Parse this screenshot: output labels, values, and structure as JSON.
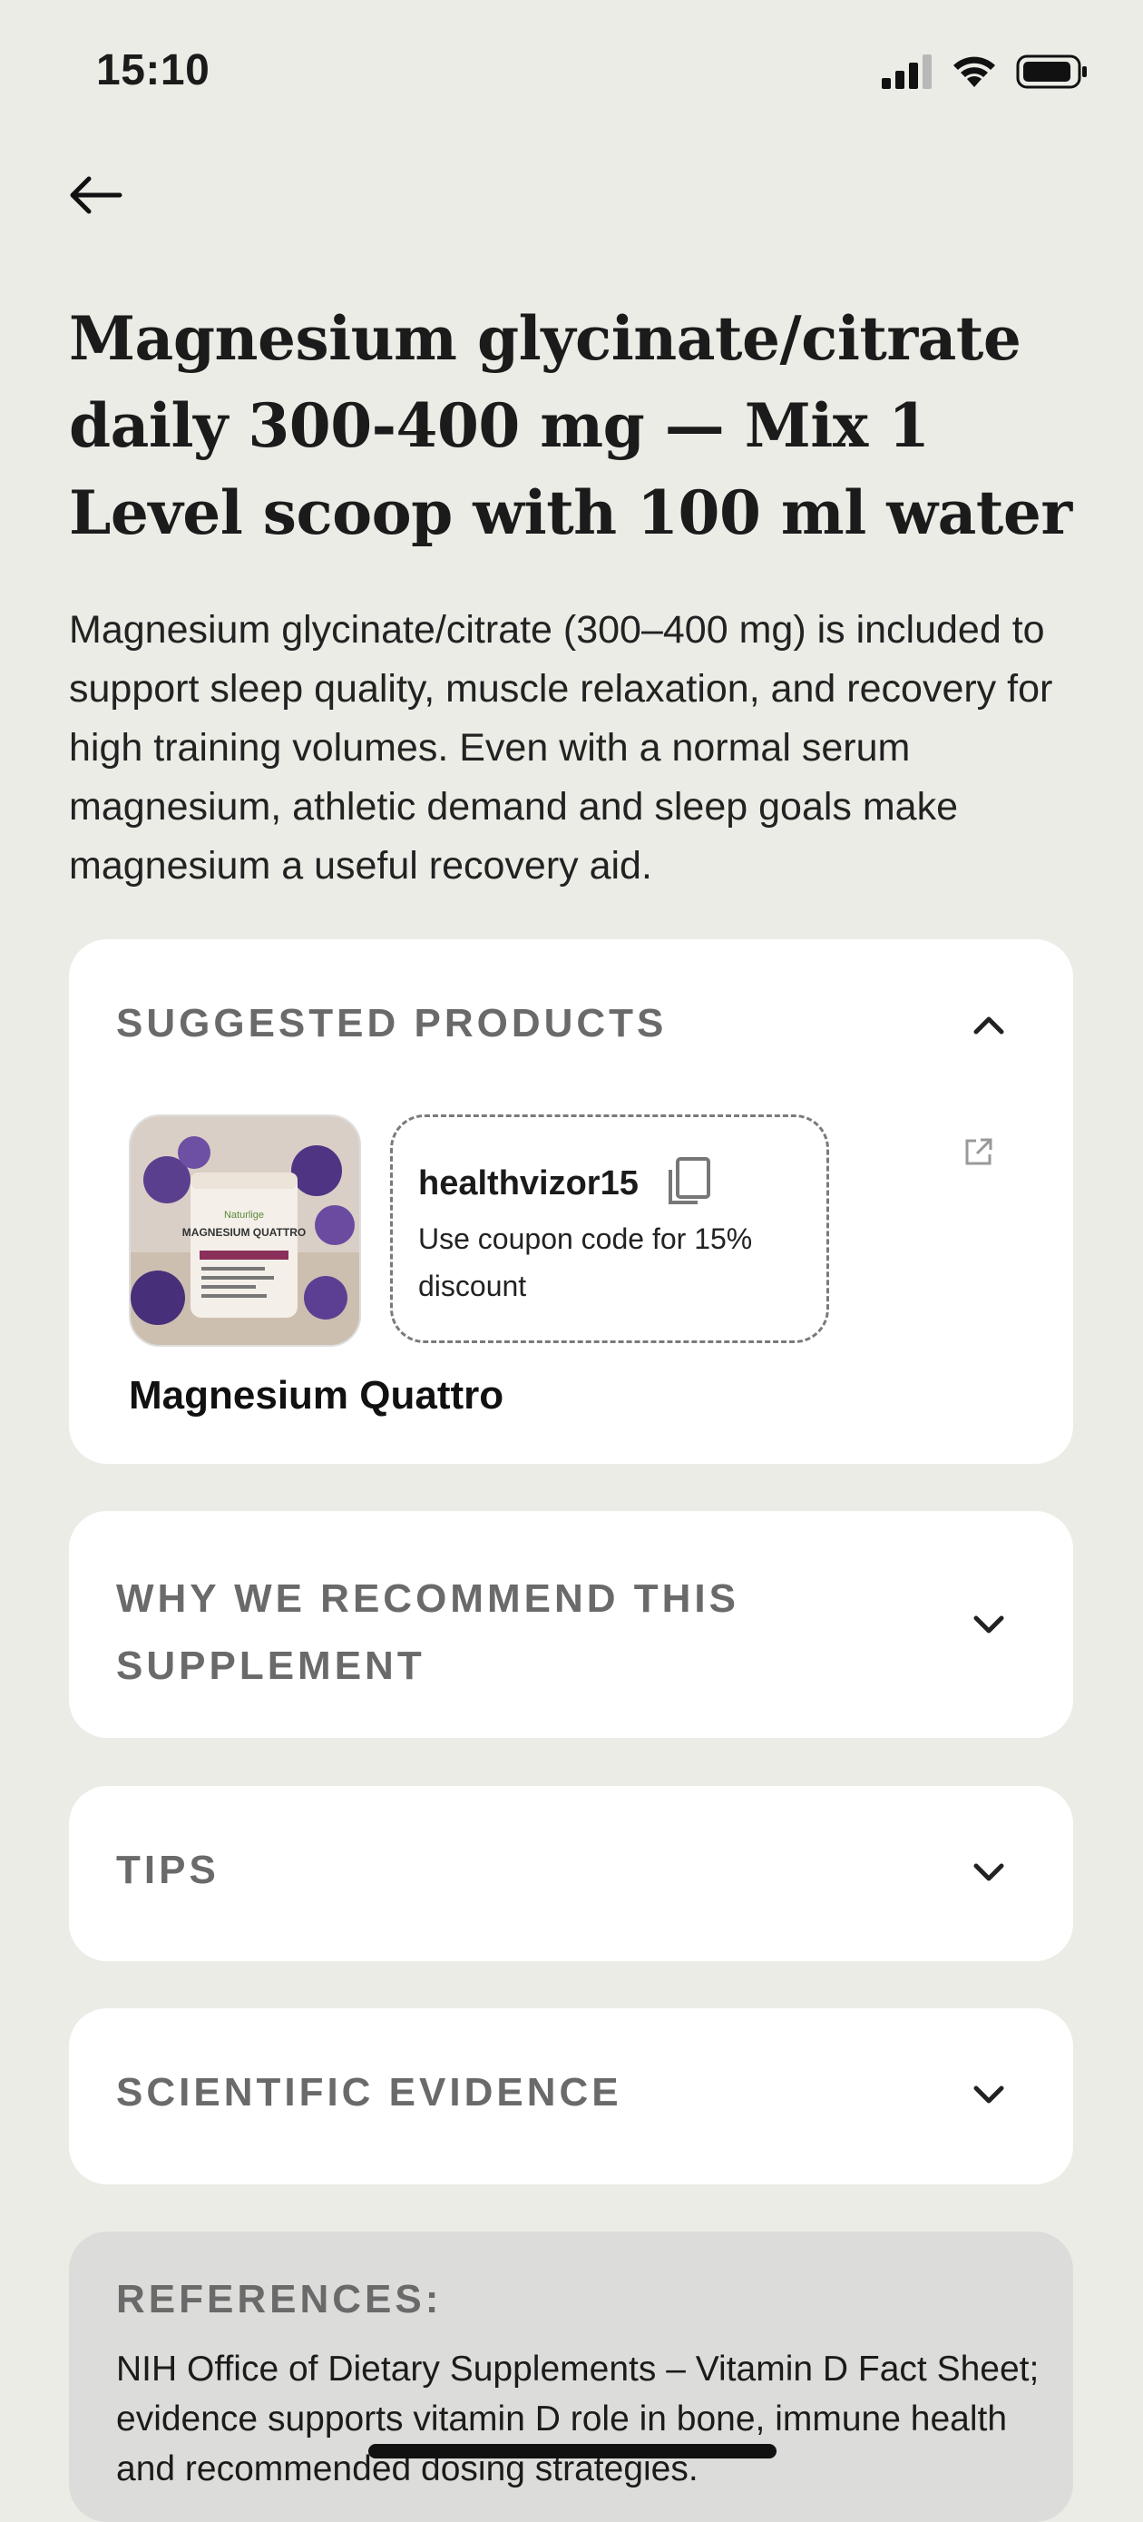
{
  "status_bar": {
    "time": "15:10"
  },
  "header": {
    "title": "Magnesium glycinate/citrate daily 300-400 mg — Mix 1 Level scoop with 100 ml water",
    "description": "Magnesium glycinate/citrate (300–400 mg) is included to support sleep quality, muscle relaxation, and recovery for high training volumes. Even with a normal serum magnesium, athletic demand and sleep goals make magnesium a useful recovery aid."
  },
  "suggested_products": {
    "heading": "SUGGESTED PRODUCTS",
    "expanded": true,
    "product": {
      "name": "Magnesium Quattro",
      "image_label_brand": "Naturlige",
      "image_label_title": "MAGNESIUM QUATTRO",
      "coupon_code": "healthvizor15",
      "coupon_note": "Use coupon code for 15% discount"
    }
  },
  "sections": {
    "why": "WHY WE RECOMMEND THIS SUPPLEMENT",
    "tips": "TIPS",
    "evidence": "SCIENTIFIC EVIDENCE"
  },
  "references": {
    "heading": "REFERENCES:",
    "text": "NIH Office of Dietary Supplements – Vitamin D Fact Sheet; evidence supports vitamin D role in bone, immune health and recommended dosing strategies."
  },
  "colors": {
    "background": "#ebece6",
    "card": "#ffffff",
    "references_card": "#dcdcda",
    "section_heading": "#6a6a6a"
  },
  "icons": [
    "signal-icon",
    "wifi-icon",
    "battery-icon",
    "back-arrow-icon",
    "chevron-up-icon",
    "chevron-down-icon",
    "copy-icon",
    "external-link-icon"
  ]
}
